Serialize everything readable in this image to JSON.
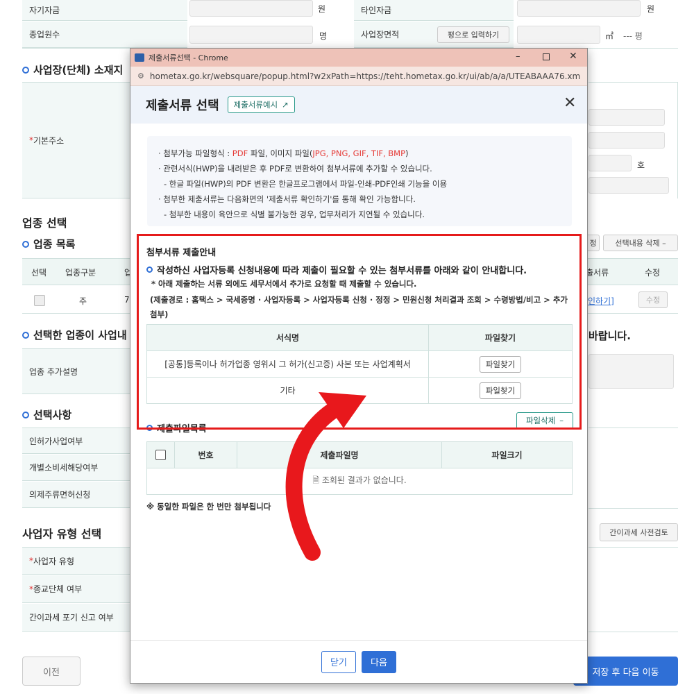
{
  "bg": {
    "row1": {
      "label_left": "자기자금",
      "unit_left": "원",
      "label_right": "타인자금",
      "unit_right": "원"
    },
    "row2": {
      "label_left": "종업원수",
      "unit_left": "명",
      "label_right": "사업장면적",
      "pyeong_button": "평으로 입력하기",
      "unit_m2": "㎡",
      "unit_pyeong": "--- 평"
    },
    "address_section": "사업장(단체) 소재지",
    "basic_address": "기본주소",
    "unit_ho": "호",
    "industry_title": "업종 선택",
    "industry_list": "업종 목록",
    "btn_select_fragment": "정",
    "btn_delete_selected": "선택내용 삭제",
    "table_headers": [
      "선택",
      "업종구분",
      "업",
      "출서류",
      "수정"
    ],
    "table_row": {
      "type": "주",
      "code_fragment": "7",
      "link_fragment": "인하기]",
      "edit": "수정"
    },
    "selected_notice_left": "선택한 업종이 사업내",
    "selected_notice_right": "바랍니다.",
    "industry_extra": "업종 추가설명",
    "options_title": "선택사항",
    "options": [
      "인허가사업여부",
      "개별소비세해당여부",
      "의제주류면허신청"
    ],
    "biz_type_title": "사업자 유형 선택",
    "simple_tax_button": "간이과세 사전검토",
    "biz_rows": [
      "사업자 유형",
      "종교단체 여부",
      "간이과세 포기 신고 여부"
    ],
    "prev_button": "이전",
    "next_button": "저장 후 다음 이동"
  },
  "popup": {
    "window_title": "제출서류선택 - Chrome",
    "url": "hometax.go.kr/websquare/popup.html?w2xPath=https://teht.hometax.go.kr/ui/ab/a/a/UTEABAAA76.xml&pop...",
    "title": "제출서류 선택",
    "example_button": "제출서류예시",
    "info": {
      "line1_a": "· 첨부가능 파일형식 : ",
      "line1_pdf": "PDF",
      "line1_b": " 파일, 이미지 파일(",
      "line1_img": "JPG, PNG, GIF, TIF, BMP",
      "line1_c": ")",
      "line2": "· 관련서식(HWP)을 내려받은 후 PDF로 변환하여 첨부서류에 추가할 수 있습니다.",
      "line3": "- 한글 파일(HWP)의 PDF 변환은 한글프로그램에서 파일-인쇄-PDF인쇄 기능을 이용",
      "line4": "· 첨부한 제출서류는 다음화면의 '제출서류 확인하기'를 통해 확인 가능합니다.",
      "line5": "- 첨부한 내용이 육안으로 식별 불가능한 경우, 업무처리가 지연될 수 있습니다."
    },
    "guide_title": "첨부서류 제출안내",
    "guide_bullet": "작성하신 사업자등록 신청내용에 따라 제출이 필요할 수 있는 첨부서류를 아래와 같이 안내합니다.",
    "guide_note1": "* 아래 제출하는 서류 외에도 세무서에서 추가로 요청할 때 제출할 수 있습니다.",
    "guide_note2": "(제출경로 : 홈택스 > 국세증명 · 사업자등록 > 사업자등록 신청 · 정정 > 민원신청 처리결과 조회 > 수령방법/비고 > 추가첨부)",
    "doc_table": {
      "headers": [
        "서식명",
        "파일찾기"
      ],
      "rows": [
        {
          "name": "[공통]등록이나 허가업종 영위시 그 허가(신고증) 사본 또는 사업계획서",
          "button": "파일찾기"
        },
        {
          "name": "기타",
          "button": "파일찾기"
        }
      ]
    },
    "file_delete_button": "파일삭제",
    "file_list_title": "제출파일목록",
    "file_table": {
      "headers": [
        "번호",
        "제출파일명",
        "파일크기"
      ],
      "empty": "조회된 결과가 없습니다."
    },
    "duplicate_note": "※ 동일한 파일은 한 번만 첨부됩니다",
    "close_button": "닫기",
    "next_button": "다음"
  },
  "colors": {
    "accent": "#2f6fd6",
    "highlight": "#e51b1b",
    "arrow": "#e8181c"
  }
}
